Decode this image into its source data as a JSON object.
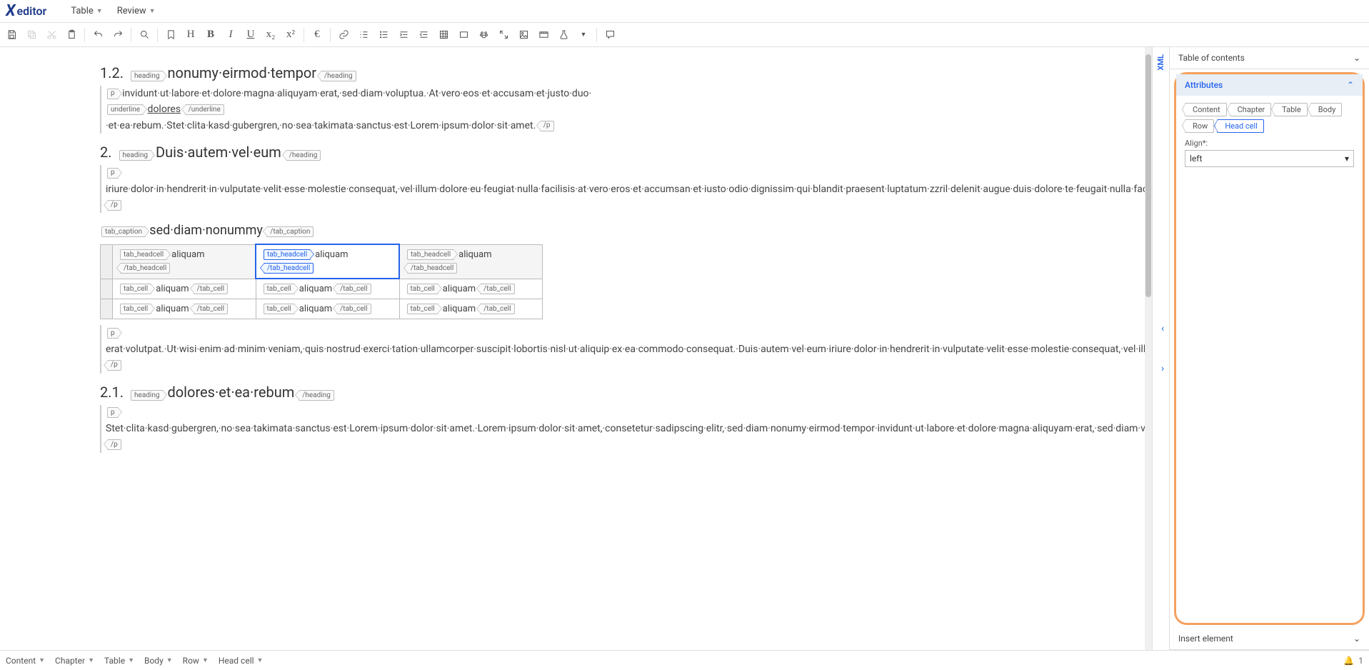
{
  "app": {
    "logo_text": "editor"
  },
  "menubar": {
    "items": [
      "Table",
      "Review"
    ]
  },
  "toolbar": {
    "groups": [
      [
        {
          "n": "save-icon"
        },
        {
          "n": "copy-icon",
          "d": true
        },
        {
          "n": "cut-icon",
          "d": true
        },
        {
          "n": "paste-icon"
        }
      ],
      [
        {
          "n": "undo-icon"
        },
        {
          "n": "redo-icon"
        }
      ],
      [
        {
          "n": "search-icon"
        }
      ],
      [
        {
          "n": "bookmark-icon"
        },
        {
          "n": "heading-icon",
          "t": "H"
        },
        {
          "n": "bold-icon",
          "t": "B",
          "b": true
        },
        {
          "n": "italic-icon",
          "t": "I",
          "i": true
        },
        {
          "n": "underline-icon",
          "t": "U",
          "u": true
        },
        {
          "n": "subscript-icon",
          "t": "x₂"
        },
        {
          "n": "superscript-icon",
          "t": "x²"
        }
      ],
      [
        {
          "n": "euro-icon",
          "t": "€"
        }
      ],
      [
        {
          "n": "link-icon"
        },
        {
          "n": "ol-icon"
        },
        {
          "n": "ul-icon"
        },
        {
          "n": "indent-icon"
        },
        {
          "n": "outdent-icon"
        },
        {
          "n": "table-icon"
        },
        {
          "n": "container-icon"
        },
        {
          "n": "paw-icon"
        },
        {
          "n": "expand-icon"
        },
        {
          "n": "image-icon"
        },
        {
          "n": "video-icon"
        },
        {
          "n": "flask-icon"
        },
        {
          "n": "dropdown-icon"
        }
      ],
      [
        {
          "n": "comment-icon"
        }
      ]
    ]
  },
  "doc": {
    "sections": [
      {
        "num": "1.2.",
        "title": "nonumy·eirmod·tempor",
        "tag": "heading",
        "paras": [
          {
            "tag": "p",
            "runs": [
              {
                "t": "invidunt·ut·labore·et·dolore·magna·aliquyam·erat,·sed·diam·voluptua.·At·vero·eos·et·accusam·et·justo·duo·"
              },
              {
                "open": "underline",
                "t": "dolores",
                "close": "underline",
                "u": true
              },
              {
                "t": "·et·ea·rebum.·Stet·clita·kasd·gubergren,·no·sea·takimata·sanctus·est·Lorem·ipsum·dolor·sit·amet."
              }
            ]
          }
        ]
      },
      {
        "num": "2.",
        "title": "Duis·autem·vel·eum",
        "tag": "heading",
        "paras": [
          {
            "tag": "p",
            "runs": [
              {
                "t": "iriure·dolor·in·hendrerit·in·vulputate·velit·esse·molestie·consequat,·vel·illum·dolore·eu·feugiat·nulla·facilisis·at·vero·eros·et·accumsan·et·iusto·odio·dignissim·qui·blandit·praesent·luptatum·zzril·delenit·augue·duis·dolore·te·feugait·nulla·facilisi.·Nam·liber·tempor·cum·soluta·nobis·eleifend·option·congue·nihil·imperdiet·doming·amet,·consectetuer·adipiscing·elit,·sed·diam·nonummy·nibh·euismod·tincidunt·ut·laoreet·dolore·magna"
              }
            ]
          }
        ],
        "caption": {
          "tag": "tab_caption",
          "text": "sed·diam·nonummy"
        },
        "table": {
          "head_tag": "tab_headcell",
          "cell_tag": "tab_cell",
          "head": [
            "aliquam",
            "aliquam",
            "aliquam"
          ],
          "selected_col": 1,
          "rows": [
            [
              "aliquam",
              "aliquam",
              "aliquam"
            ],
            [
              "aliquam",
              "aliquam",
              "aliquam"
            ]
          ]
        },
        "after_paras": [
          {
            "tag": "p",
            "runs": [
              {
                "t": "erat·volutpat.·Ut·wisi·enim·ad·minim·veniam,·quis·nostrud·exerci·tation·ullamcorper·suscipit·lobortis·nisl·ut·aliquip·ex·ea·commodo·consequat.·Duis·autem·vel·eum·iriure·dolor·in·hendrerit·in·vulputate·velit·esse·molestie·consequat,·vel·illum·dolore·eu·feugiat·nulla·facilisis.·At·vero·eos·et·accusam·et·justo·duo"
              }
            ]
          }
        ]
      },
      {
        "num": "2.1.",
        "title": "dolores·et·ea·rebum",
        "tag": "heading",
        "paras": [
          {
            "tag": "p",
            "runs": [
              {
                "t": "Stet·clita·kasd·gubergren,·no·sea·takimata·sanctus·est·Lorem·ipsum·dolor·sit·amet.·Lorem·ipsum·dolor·sit·amet,·consetetur·sadipscing·elitr,·sed·diam·nonumy·eirmod·tempor·invidunt·ut·labore·et·dolore·magna·aliquyam·erat,·sed·diam·voluptua.·At·vero·eos·et·accusam·et·justo·duo·dolores·et·ea·rebum.·Stet·clita·kasd·gubergren,·no·sea·takimata·sanctus·est·Lorem·ipsum·dolor·sit·amet.·Lorem·ipsum·dolor·sit·amet,·consetetur·sadipscing·elitr,·At·accusam·aliquyam·diam·diam·dolore·dolores·duo·eirmod·eos·erat,·et·nonumy·sed·tempor·et·et·invidunt·justo·labore·Stet·clita"
              }
            ]
          }
        ]
      }
    ]
  },
  "side": {
    "xml_tab": "XML",
    "toc_header": "Table of contents",
    "attr_header": "Attributes",
    "insert_header": "Insert element",
    "breadcrumb": [
      "Content",
      "Chapter",
      "Table",
      "Body",
      "Row",
      "Head cell"
    ],
    "breadcrumb_active": 5,
    "align_label": "Align*:",
    "align_value": "left"
  },
  "bottom": {
    "crumbs": [
      "Content",
      "Chapter",
      "Table",
      "Body",
      "Row",
      "Head cell"
    ],
    "notif_count": "1"
  }
}
